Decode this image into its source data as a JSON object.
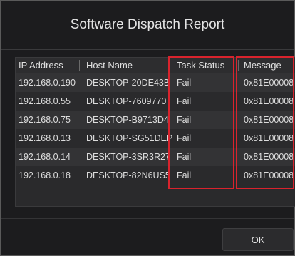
{
  "dialog": {
    "title": "Software Dispatch Report",
    "ok_label": "OK"
  },
  "table": {
    "columns": [
      "IP Address",
      "Host Name",
      "Task Status",
      "Message"
    ],
    "rows": [
      {
        "ip": "192.168.0.190",
        "host": "DESKTOP-20DE43B",
        "status": "Fail",
        "message": "0x81E00008"
      },
      {
        "ip": "192.168.0.55",
        "host": "DESKTOP-7609770",
        "status": "Fail",
        "message": "0x81E00008"
      },
      {
        "ip": "192.168.0.75",
        "host": "DESKTOP-B9713D4",
        "status": "Fail",
        "message": "0x81E00008"
      },
      {
        "ip": "192.168.0.13",
        "host": "DESKTOP-SG51DEP",
        "status": "Fail",
        "message": "0x81E00008"
      },
      {
        "ip": "192.168.0.14",
        "host": "DESKTOP-3SR3R27",
        "status": "Fail",
        "message": "0x81E00008"
      },
      {
        "ip": "192.168.0.18",
        "host": "DESKTOP-82N6US5",
        "status": "Fail",
        "message": "0x81E00008"
      }
    ]
  },
  "colors": {
    "background": "#1c1c1e",
    "highlight": "#d9232d",
    "row_alt": "#333335"
  }
}
